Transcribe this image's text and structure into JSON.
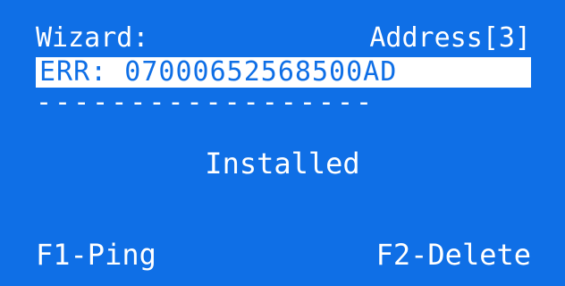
{
  "header": {
    "title": "Wizard:",
    "address": "Address[3]"
  },
  "error_line": "ERR: 070006525685​00AD",
  "divider": "------------------",
  "status": "Installed",
  "footer": {
    "f1_label": "F1-Ping",
    "f2_label": "F2-Delete"
  },
  "colors": {
    "screen_bg": "#0f6fe6",
    "text": "#ffffff",
    "highlight_bg": "#ffffff"
  }
}
